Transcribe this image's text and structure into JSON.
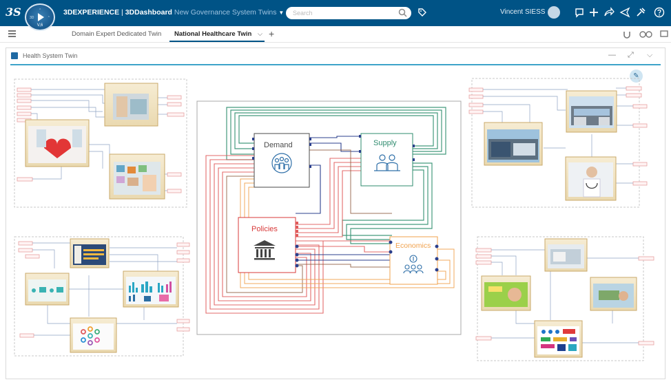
{
  "brand": {
    "logo_text": "3S",
    "compass_version": "V,6",
    "app_name": "3DEXPERIENCE",
    "app_separator": "|",
    "dashboard": "3DDashboard",
    "dashboard_name": "New Governance System Twins"
  },
  "search": {
    "placeholder": "Search"
  },
  "user": {
    "name": "Vincent SIESS"
  },
  "tabs": [
    {
      "label": "Domain Expert Dedicated Twin"
    },
    {
      "label": "National Healthcare Twin"
    }
  ],
  "widget": {
    "title": "Health System Twin"
  },
  "model": {
    "nodes": [
      {
        "label": "Demand"
      },
      {
        "label": "Supply"
      },
      {
        "label": "Policies"
      },
      {
        "label": "Economics"
      }
    ]
  },
  "colors": {
    "header": "#005386",
    "demand": "#4a4a4a",
    "supply": "#2e8b6e",
    "policies": "#d83a3a",
    "economics": "#f0a04b",
    "wire_red": "#e05a5a",
    "wire_green": "#2f8f6f",
    "wire_blue": "#2b3f8c",
    "wire_brown": "#8b5a3c"
  },
  "icons": [
    "search-icon",
    "tag-icon",
    "avatar",
    "comment-icon",
    "add-icon",
    "share-icon",
    "send-icon",
    "tools-icon",
    "help-icon",
    "hamburger-icon"
  ]
}
